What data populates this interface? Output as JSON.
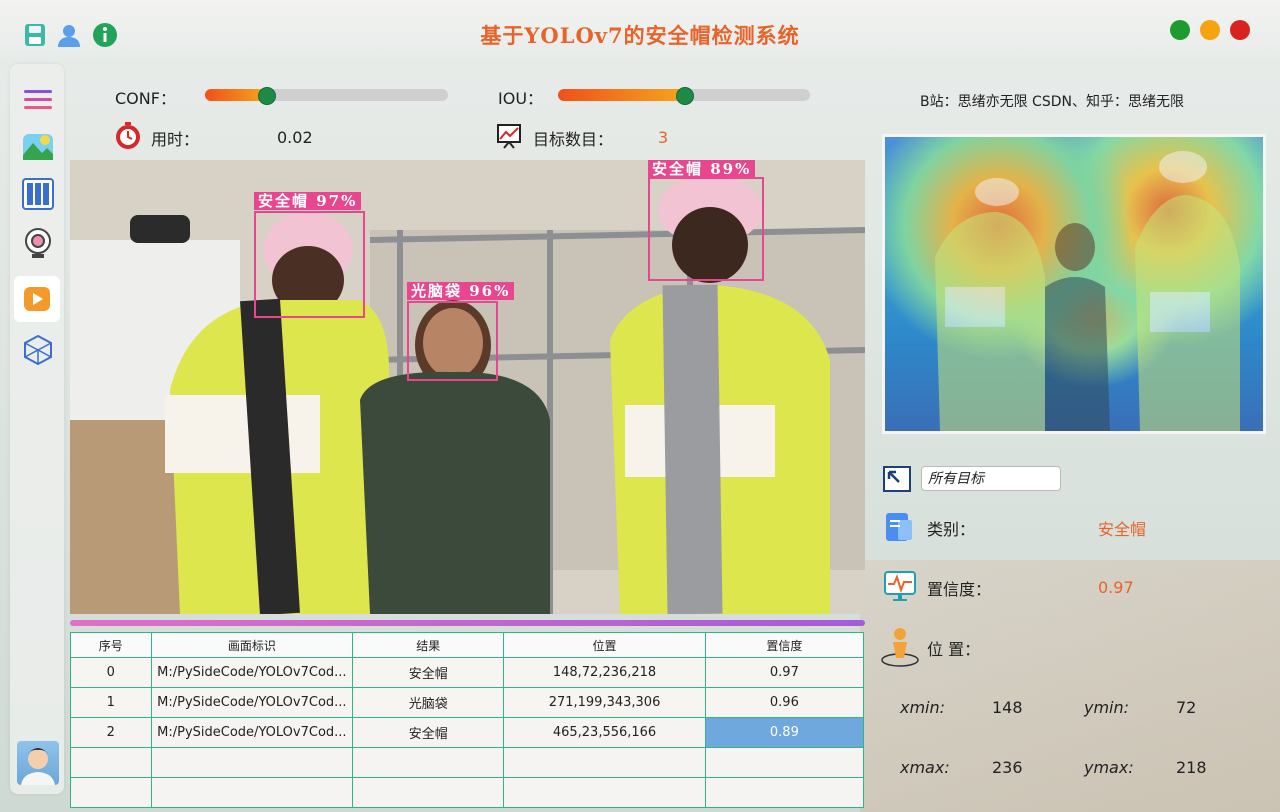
{
  "title": "基于YOLOv7的安全帽检测系统",
  "credit": "B站：思绪亦无限  CSDN、知乎：思绪无限",
  "colors": {
    "accent": "#e8632a",
    "detection": "#e8478f",
    "grid": "#2fb58a",
    "selected": "#6fa8dc"
  },
  "top_icons": [
    "save-icon",
    "user-icon",
    "info-icon"
  ],
  "window_buttons": [
    "maximize-button-green",
    "minimize-button-yellow",
    "close-button-red"
  ],
  "sidebar": [
    "menu-icon",
    "image-file-icon",
    "batch-folder-icon",
    "camera-icon",
    "video-icon",
    "model-icon",
    "avatar"
  ],
  "controls": {
    "conf_label": "CONF：",
    "conf_value": 0.25,
    "iou_label": "IOU：",
    "iou_value": 0.5,
    "time_label": "用时：",
    "time_value": "0.02",
    "count_label": "目标数目：",
    "count_value": "3"
  },
  "detections": [
    {
      "label": "安全帽  97%"
    },
    {
      "label": "光脑袋  96%"
    },
    {
      "label": "安全帽  89%"
    }
  ],
  "table": {
    "headers": [
      "序号",
      "画面标识",
      "结果",
      "位置",
      "置信度"
    ],
    "rows": [
      [
        "0",
        "M:/PySideCode/YOLOv7Cod...",
        "安全帽",
        "148,72,236,218",
        "0.97"
      ],
      [
        "1",
        "M:/PySideCode/YOLOv7Cod...",
        "光脑袋",
        "271,199,343,306",
        "0.96"
      ],
      [
        "2",
        "M:/PySideCode/YOLOv7Cod...",
        "安全帽",
        "465,23,556,166",
        "0.89"
      ]
    ]
  },
  "details": {
    "target_select": "所有目标",
    "category_label": "类别：",
    "category_value": "安全帽",
    "confidence_label": "置信度：",
    "confidence_value": "0.97",
    "position_label": "位  置：",
    "xmin_label": "xmin:",
    "xmin_value": "148",
    "ymin_label": "ymin:",
    "ymin_value": "72",
    "xmax_label": "xmax:",
    "xmax_value": "236",
    "ymax_label": "ymax:",
    "ymax_value": "218"
  }
}
